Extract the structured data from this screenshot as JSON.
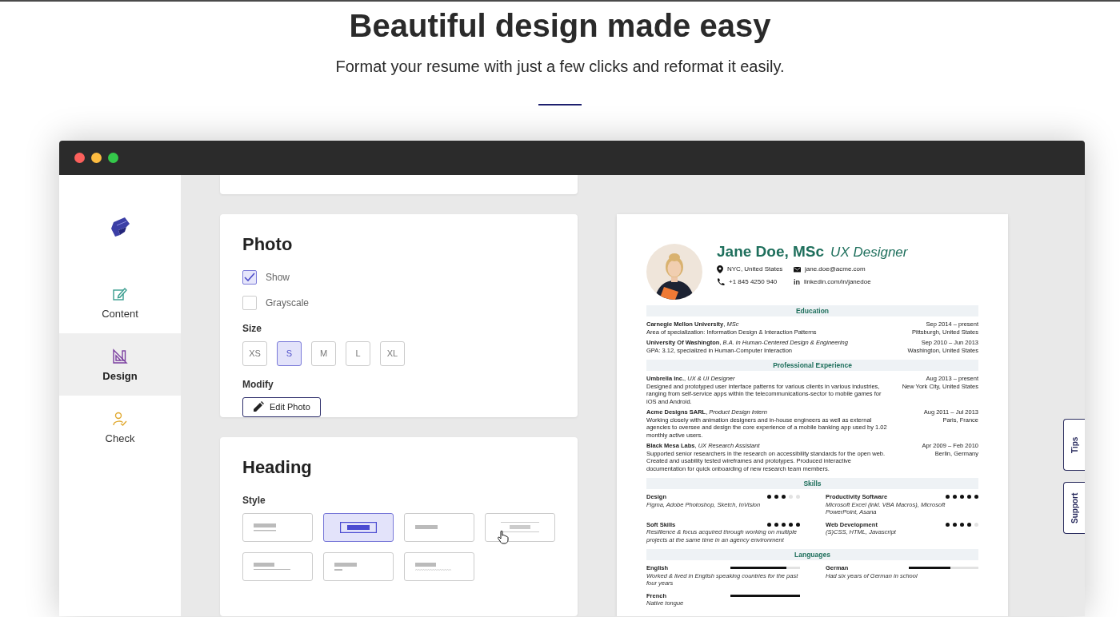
{
  "hero": {
    "title": "Beautiful design made easy",
    "subtitle": "Format your resume with just a few clicks and reformat it easily."
  },
  "sidebar": {
    "items": [
      {
        "kind": "content",
        "label": "Content",
        "selected": false
      },
      {
        "kind": "design",
        "label": "Design",
        "selected": true
      },
      {
        "kind": "check",
        "label": "Check",
        "selected": false
      }
    ]
  },
  "photo_panel": {
    "title": "Photo",
    "checkboxes": [
      {
        "label": "Show",
        "checked": true
      },
      {
        "label": "Grayscale",
        "checked": false
      }
    ],
    "size_label": "Size",
    "sizes": [
      {
        "label": "XS",
        "selected": false
      },
      {
        "label": "S",
        "selected": true
      },
      {
        "label": "M",
        "selected": false
      },
      {
        "label": "L",
        "selected": false
      },
      {
        "label": "XL",
        "selected": false
      }
    ],
    "modify_label": "Modify",
    "edit_button": "Edit Photo"
  },
  "heading_panel": {
    "title": "Heading",
    "style_label": "Style",
    "styles": [
      {
        "kind": "underline",
        "selected": false
      },
      {
        "kind": "boxed",
        "selected": true
      },
      {
        "kind": "plain",
        "selected": false
      },
      {
        "kind": "lines",
        "selected": false
      },
      {
        "kind": "long-underline",
        "selected": false
      },
      {
        "kind": "sub-bar",
        "selected": false
      },
      {
        "kind": "wavy",
        "selected": false
      }
    ]
  },
  "resume": {
    "name": "Jane Doe, MSc",
    "role": "UX Designer",
    "contacts": [
      {
        "kind": "location",
        "text": "NYC, United States"
      },
      {
        "kind": "email",
        "text": "jane.doe@acme.com"
      },
      {
        "kind": "phone",
        "text": "+1 845 4250 940"
      },
      {
        "kind": "linkedin",
        "icon_text": "in",
        "text": "linkedin.com/in/janedoe"
      }
    ],
    "sections": [
      {
        "kind": "entries",
        "title": "Education",
        "entries": [
          {
            "heading": "**Carnegie Mellon University**, *MSc*",
            "details": "Area of specialization: Information Design & Interaction Patterns",
            "date": "Sep 2014 – present",
            "place": "Pittsburgh, United States"
          },
          {
            "heading": "**University Of Washington**, *B.A. in Human-Centered Design & Engineering*",
            "details": "GPA: 3.12, specialized in Human-Computer Interaction",
            "date": "Sep 2010 – Jun 2013",
            "place": "Washington, United States"
          }
        ]
      },
      {
        "kind": "entries",
        "title": "Professional Experience",
        "entries": [
          {
            "heading": "**Umbrella Inc.**, *UX & UI Designer*",
            "details": "Designed and prototyped user interface patterns for various clients in various industries, ranging from self-service apps within the telecommunications-sector to mobile games for iOS and Android.",
            "date": "Aug 2013 – present",
            "place": "New York City, United States"
          },
          {
            "heading": "**Acme Designs SARL**, *Product Design Intern*",
            "details": "Working closely with animation designers and in-house engineers as well as external agencies to oversee and design the core experience of a mobile banking app used by 1.02 monthly active users.",
            "date": "Aug 2011 – Jul 2013",
            "place": "Paris, France"
          },
          {
            "heading": "**Black Mesa Labs**, *UX Research Assistant*",
            "details": "Supported senior researchers in the research on accessibility standards for the open web. Created and usability tested wireframes and prototypes. Produced interactive documentation for quick onboarding of new research team members.",
            "date": "Apr 2009 – Feb 2010",
            "place": "Berlin, Germany"
          }
        ]
      },
      {
        "kind": "skills",
        "title": "Skills",
        "items": [
          {
            "name": "Design",
            "stars": 3,
            "description": "Figma, Adobe Photoshop, Sketch, InVision"
          },
          {
            "name": "Productivity Software",
            "stars": 5,
            "description": "Microsoft Excel (inkl. VBA Macros), Microsoft PowerPoint, Asana"
          },
          {
            "name": "Soft Skills",
            "stars": 5,
            "description": "Resillience & focus acquired through working on multiple projects at the same time in an agency environment"
          },
          {
            "name": "Web Development",
            "stars": 4,
            "description": "(S)CSS, HTML, Javascript"
          }
        ]
      },
      {
        "kind": "languages",
        "title": "Languages",
        "items": [
          {
            "name": "English",
            "level": 0.8,
            "description": "Worked & lived in English speaking countries for the past four years"
          },
          {
            "name": "German",
            "level": 0.6,
            "description": "Had six years of German in school"
          },
          {
            "name": "French",
            "level": 1,
            "description": "Native tongue"
          }
        ]
      }
    ]
  },
  "side_tabs": [
    "Tips",
    "Support"
  ]
}
